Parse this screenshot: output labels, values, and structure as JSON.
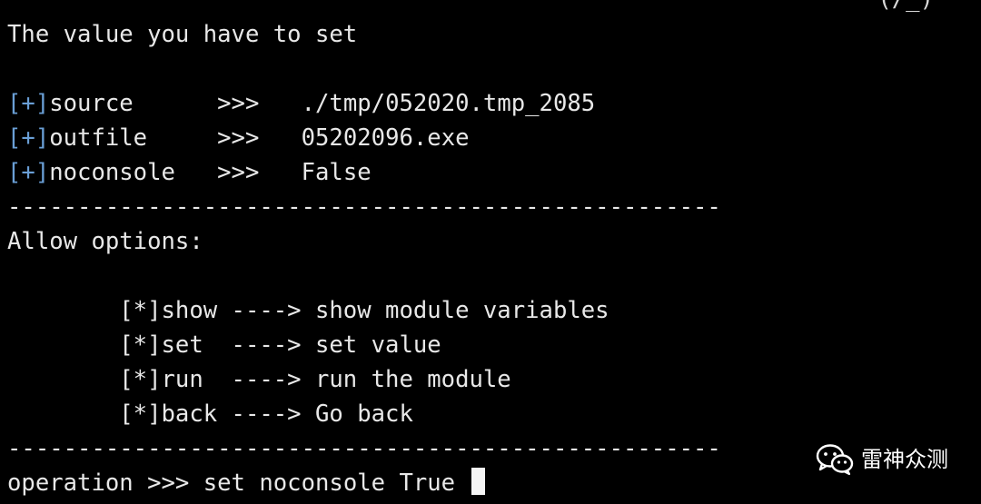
{
  "terminal": {
    "top_fragment": "(/_)",
    "heading": "The value you have to set",
    "values": [
      {
        "marker": "[+]",
        "name": "source    ",
        "arrow": "  >>>  ",
        "value": " ./tmp/052020.tmp_2085"
      },
      {
        "marker": "[+]",
        "name": "outfile   ",
        "arrow": "  >>>  ",
        "value": " 05202096.exe"
      },
      {
        "marker": "[+]",
        "name": "noconsole ",
        "arrow": "  >>>  ",
        "value": " False"
      }
    ],
    "separator": "---------------------------------------------------",
    "allow_heading": "Allow options:",
    "options": [
      {
        "text": "        [*]show ----> show module variables"
      },
      {
        "text": "        [*]set  ----> set value"
      },
      {
        "text": "        [*]run  ----> run the module"
      },
      {
        "text": "        [*]back ----> Go back"
      }
    ],
    "prompt": "operation >>> ",
    "command": "set noconsole True "
  },
  "watermark": {
    "text": "雷神众测",
    "icon": "wechat-icon"
  }
}
